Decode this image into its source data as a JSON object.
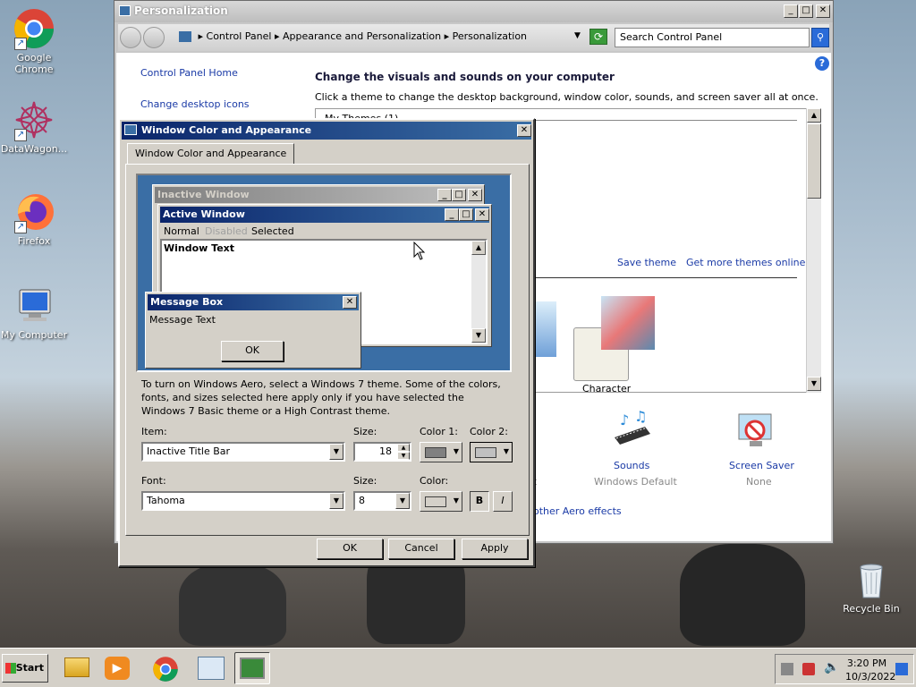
{
  "desktop": {
    "icons": [
      {
        "label": "Google Chrome"
      },
      {
        "label": "DataWagon..."
      },
      {
        "label": "Firefox"
      },
      {
        "label": "My Computer"
      },
      {
        "label": "Recycle Bin"
      }
    ]
  },
  "personalization": {
    "title": "Personalization",
    "breadcrumb": [
      "Control Panel",
      "Appearance and Personalization",
      "Personalization"
    ],
    "search_placeholder": "Search Control Panel",
    "sidebar": {
      "home": "Control Panel Home",
      "desktop_icons": "Change desktop icons"
    },
    "heading": "Change the visuals and sounds on your computer",
    "subheading": "Click a theme to change the desktop background, window color, sounds, and screen saver all at once.",
    "my_themes": "My Themes (1)",
    "save_theme": "Save theme",
    "get_more": "Get more themes online",
    "theme_label": "Character",
    "sounds": {
      "title": "Sounds",
      "value": "Windows Default"
    },
    "screensaver": {
      "title": "Screen Saver",
      "value": "None"
    },
    "aero_link": "other Aero effects",
    "aero_link_prefix": "t"
  },
  "dialog": {
    "title": "Window Color and Appearance",
    "tab": "Window Color and Appearance",
    "preview": {
      "inactive_title": "Inactive Window",
      "active_title": "Active Window",
      "menu_normal": "Normal",
      "menu_disabled": "Disabled",
      "menu_selected": "Selected",
      "window_text": "Window Text",
      "msg_title": "Message Box",
      "msg_text": "Message Text",
      "msg_ok": "OK"
    },
    "info": "To turn on Windows Aero, select a Windows 7 theme.  Some of the colors, fonts, and sizes selected here apply only if you have selected the Windows 7 Basic theme or a High Contrast theme.",
    "item_label": "Item:",
    "item_value": "Inactive Title Bar",
    "size_label": "Size:",
    "item_size": "18",
    "color1_label": "Color 1:",
    "color2_label": "Color 2:",
    "font_label": "Font:",
    "font_value": "Tahoma",
    "font_size_label": "Size:",
    "font_size": "8",
    "color_label": "Color:",
    "bold": "B",
    "italic": "I",
    "ok": "OK",
    "cancel": "Cancel",
    "apply": "Apply"
  },
  "taskbar": {
    "start": "Start",
    "time": "3:20 PM",
    "date": "10/3/2022"
  },
  "colors": {
    "active_title": "#0a246a",
    "inactive_title": "#808080",
    "preview_bg": "#3a6ea5",
    "link": "#1a3aa6"
  }
}
